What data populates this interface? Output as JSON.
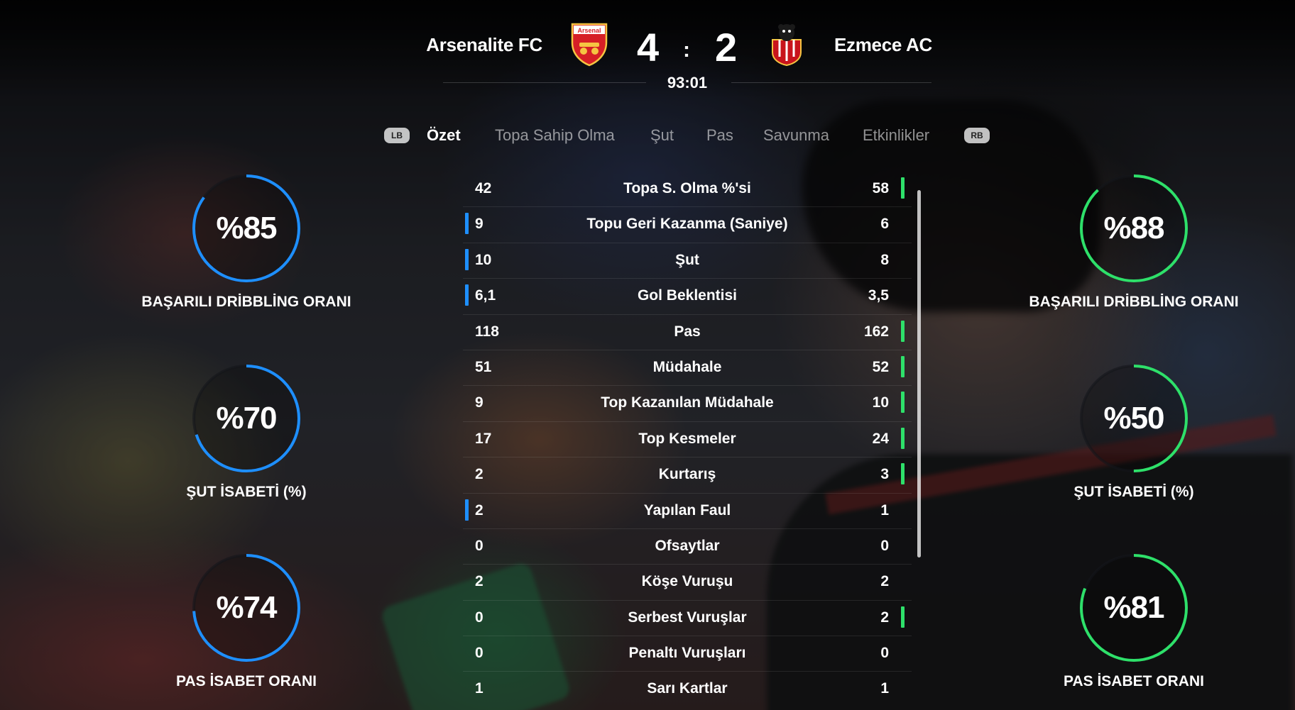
{
  "match": {
    "home": {
      "name": "Arsenalite FC",
      "score": "4",
      "crest_text": "Arsenal"
    },
    "away": {
      "name": "Ezmece AC",
      "score": "2"
    },
    "separator": ":",
    "clock": "93:01"
  },
  "tabs": {
    "lb": "LB",
    "rb": "RB",
    "items": [
      "Özet",
      "Topa Sahip Olma",
      "Şut",
      "Pas",
      "Savunma",
      "Etkinlikler"
    ],
    "active": "Özet"
  },
  "stats": [
    {
      "label": "Topa S. Olma %'si",
      "home": "42",
      "away": "58",
      "leader": "away"
    },
    {
      "label": "Topu Geri Kazanma (Saniye)",
      "home": "9",
      "away": "6",
      "leader": "home"
    },
    {
      "label": "Şut",
      "home": "10",
      "away": "8",
      "leader": "home"
    },
    {
      "label": "Gol Beklentisi",
      "home": "6,1",
      "away": "3,5",
      "leader": "home"
    },
    {
      "label": "Pas",
      "home": "118",
      "away": "162",
      "leader": "away"
    },
    {
      "label": "Müdahale",
      "home": "51",
      "away": "52",
      "leader": "away"
    },
    {
      "label": "Top Kazanılan Müdahale",
      "home": "9",
      "away": "10",
      "leader": "away"
    },
    {
      "label": "Top Kesmeler",
      "home": "17",
      "away": "24",
      "leader": "away"
    },
    {
      "label": "Kurtarış",
      "home": "2",
      "away": "3",
      "leader": "away"
    },
    {
      "label": "Yapılan Faul",
      "home": "2",
      "away": "1",
      "leader": "home"
    },
    {
      "label": "Ofsaytlar",
      "home": "0",
      "away": "0",
      "leader": "none"
    },
    {
      "label": "Köşe Vuruşu",
      "home": "2",
      "away": "2",
      "leader": "none"
    },
    {
      "label": "Serbest Vuruşlar",
      "home": "0",
      "away": "2",
      "leader": "away"
    },
    {
      "label": "Penaltı Vuruşları",
      "home": "0",
      "away": "0",
      "leader": "none"
    },
    {
      "label": "Sarı Kartlar",
      "home": "1",
      "away": "1",
      "leader": "none"
    }
  ],
  "gauges": {
    "home": [
      {
        "value": "%85",
        "percent": 85,
        "label": "BAŞARILI DRİBBLİNG ORANI"
      },
      {
        "value": "%70",
        "percent": 70,
        "label": "ŞUT İSABETİ (%)"
      },
      {
        "value": "%74",
        "percent": 74,
        "label": "PAS İSABET ORANI"
      }
    ],
    "away": [
      {
        "value": "%88",
        "percent": 88,
        "label": "BAŞARILI DRİBBLİNG ORANI"
      },
      {
        "value": "%50",
        "percent": 50,
        "label": "ŞUT İSABETİ (%)"
      },
      {
        "value": "%81",
        "percent": 81,
        "label": "PAS İSABET ORANI"
      }
    ]
  },
  "colors": {
    "home_accent": "#1e8fff",
    "away_accent": "#2ee06a",
    "home_crest": "#d61f26",
    "away_crest": "#c8141c"
  }
}
